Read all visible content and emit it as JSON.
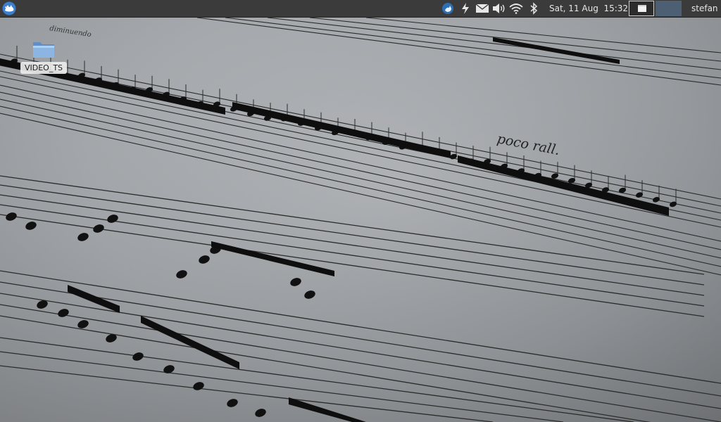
{
  "panel": {
    "menu_icon": "xfce-mouse-icon",
    "tray_icons": [
      "network-manager-icon",
      "battery-charging-icon",
      "mail-icon",
      "volume-icon",
      "wifi-icon",
      "bluetooth-icon"
    ],
    "clock": "Sat, 11 Aug  15:32",
    "workspaces": [
      "workspace-1",
      "workspace-2"
    ],
    "user": "stefan"
  },
  "desktop": {
    "icons": [
      {
        "label": "VIDEO_TS",
        "icon": "folder-icon"
      }
    ]
  },
  "wallpaper": {
    "text": "poco rall.",
    "small_text": "diminuendo"
  },
  "colors": {
    "panel_bg": "#3b3b3b",
    "active_workspace": "#4d5f73",
    "folder_blue": "#6f9fd1"
  }
}
